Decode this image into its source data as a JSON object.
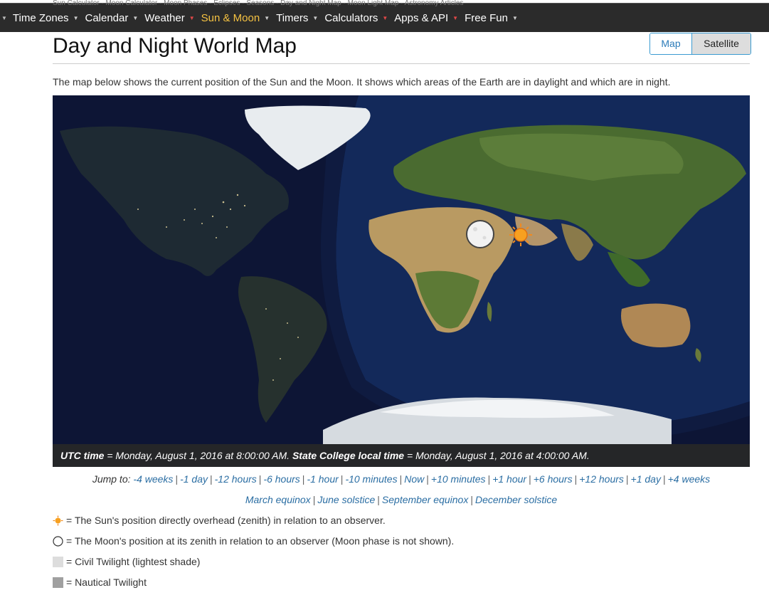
{
  "breadcrumb": "Sun Calculator · Moon Calculator · Moon Phases · Eclipses · Seasons · Day and Night Map · Moon Light Map · Astronomy Articles",
  "nav": [
    {
      "label": "Time Zones",
      "active": false
    },
    {
      "label": "Calendar",
      "active": false
    },
    {
      "label": "Weather",
      "active": false
    },
    {
      "label": "Sun & Moon",
      "active": true
    },
    {
      "label": "Timers",
      "active": false
    },
    {
      "label": "Calculators",
      "active": false
    },
    {
      "label": "Apps & API",
      "active": false
    },
    {
      "label": "Free Fun",
      "active": false
    }
  ],
  "page": {
    "title": "Day and Night World Map",
    "intro": "The map below shows the current position of the Sun and the Moon. It shows which areas of the Earth are in daylight and which are in night."
  },
  "view_toggle": {
    "map": "Map",
    "satellite": "Satellite",
    "selected": "Satellite"
  },
  "caption": {
    "utc_label": "UTC time",
    "utc_value": " = Monday, August 1, 2016 at 8:00:00 AM. ",
    "local_label": "State College local time",
    "local_value": " = Monday, August 1, 2016 at 4:00:00 AM."
  },
  "jump": {
    "label": "Jump to:",
    "links_row1": [
      "-4 weeks",
      "-1 day",
      "-12 hours",
      "-6 hours",
      "-1 hour",
      "-10 minutes",
      "Now",
      "+10 minutes",
      "+1 hour",
      "+6 hours",
      "+12 hours",
      "+1 day",
      "+4 weeks"
    ],
    "links_row2": [
      "March equinox",
      "June solstice",
      "September equinox",
      "December solstice"
    ]
  },
  "legend": [
    {
      "icon": "sun-icon",
      "text": "= The Sun's position directly overhead (zenith) in relation to an observer."
    },
    {
      "icon": "moon-icon",
      "text": "= The Moon's position at its zenith in relation to an observer (Moon phase is not shown)."
    },
    {
      "icon": "civil-swatch",
      "text": "= Civil Twilight (lightest shade)",
      "color": "#dddddd"
    },
    {
      "icon": "nautical-swatch",
      "text": "= Nautical Twilight",
      "color": "#a0a0a0"
    }
  ],
  "colors": {
    "nav_bg": "#2b2b2b",
    "nav_active": "#f5c242",
    "link": "#2b6ea3",
    "ocean": "#0c1330"
  }
}
